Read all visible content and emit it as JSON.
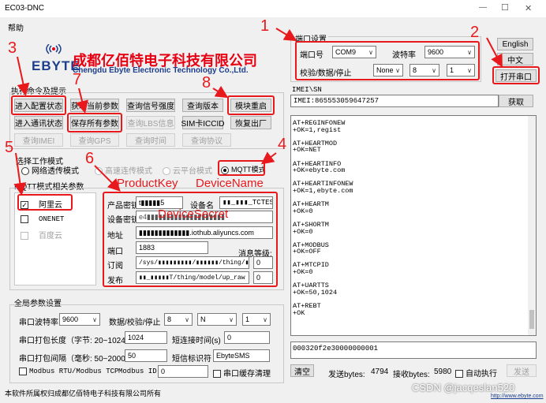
{
  "window": {
    "title": "EC03-DNC",
    "min": "—",
    "max": "☐",
    "close": "✕"
  },
  "menu": {
    "help": "帮助"
  },
  "logo": {
    "brand": "EBYTE",
    "cn": "成都亿佰特电子科技有限公司",
    "en": "Chengdu Ebyte Electronic Technology Co.,Ltd."
  },
  "serial": {
    "group_title": "端口设置",
    "port_label": "端口号",
    "port_value": "COM9",
    "baud_label": "波特率",
    "baud_value": "9600",
    "parity_label": "校验/数据/停止",
    "parity_value": "None",
    "data_bits": "8",
    "stop_bits": "1",
    "open_button": "打开串口"
  },
  "lang": {
    "english": "English",
    "chinese": "中文"
  },
  "cmd": {
    "title": "执行命令及提示",
    "buttons": [
      "进入配置状态",
      "获取当前参数",
      "查询信号强度",
      "查询版本",
      "模块重启",
      "进入通讯状态",
      "保存所有参数",
      "查询LBS信息",
      "SIM卡ICCID",
      "恢复出厂",
      "查询IMEI",
      "查询GPS",
      "查询时间",
      "查询协议"
    ]
  },
  "mode": {
    "title": "选择工作模式",
    "opt1": "网络透传模式",
    "opt2": "高速连传模式",
    "opt3": "云平台模式",
    "opt4": "MQTT模式"
  },
  "mqtt": {
    "title": "MQTT模式相关参数",
    "clouds": [
      "阿里云",
      "ONENET",
      "百度云"
    ],
    "product_key_label": "产品密钥",
    "product_key_value": "t▮▮▮▮▮5",
    "device_name_label": "设备名",
    "device_name_value": "▮▮_▮▮▮_TCTEST",
    "device_secret_label": "设备密钥",
    "device_secret_value": "e4▮▮▮▮▮▮▮▮▮▮▮▮▮▮▮▮▮▮▮▮",
    "address_label": "地址",
    "address_value": "▮▮▮▮▮▮▮▮▮▮▮▮▮.iothub.aliyuncs.com",
    "port_label": "端口",
    "port_value": "1883",
    "qos_label": "消息等级:",
    "sub_label": "订阅",
    "sub_value": "/sys/▮▮▮▮▮▮▮▮▮/▮▮▮▮▮▮/thing/▮▮▮/t",
    "sub_qos": "0",
    "pub_label": "发布",
    "pub_value": "▮▮_▮▮▮▮▮T/thing/model/up_raw",
    "pub_qos": "0"
  },
  "global": {
    "title": "全局参数设置",
    "baud_label": "串口波特率",
    "baud_value": "9600",
    "parity_label": "数据/校验/停止",
    "data_bits": "8",
    "parity": "N",
    "stop_bits": "1",
    "pack_len_label": "串口打包长度（字节: 20~1024）",
    "pack_len_value": "1024",
    "short_time_label": "短连接时间(s)",
    "short_time_value": "0",
    "pack_time_label": "串口打包间隔（毫秒: 50~2000）",
    "pack_time_value": "50",
    "sms_label": "短信标识符",
    "sms_value": "EbyteSMS",
    "modbus_label": "Modbus RTU/Modbus TCP",
    "modbus_id_label": "Modbus ID",
    "modbus_id_value": "0",
    "cache_label": "串口缓存清理"
  },
  "imei": {
    "title": "IMEI\\SN",
    "value": "IMEI:865553059647257",
    "get_button": "获取"
  },
  "log": [
    "AT+REGINFONEW",
    "+OK=1,regist",
    "",
    "AT+HEARTMOD",
    "+OK=NET",
    "",
    "AT+HEARTINFO",
    "+OK=ebyte.com",
    "",
    "AT+HEARTINFONEW",
    "+OK=1,ebyte.com",
    "",
    "AT+HEARTM",
    "+OK=0",
    "",
    "AT+SHORTM",
    "+OK=0",
    "",
    "AT+MODBUS",
    "+OK=OFF",
    "",
    "AT+MTCPID",
    "+OK=0",
    "",
    "AT+UARTTS",
    "+OK=50,1024",
    "",
    "AT+REBT",
    "+OK"
  ],
  "send": {
    "value": "000320f2e30000000001"
  },
  "bottom": {
    "clear": "清空",
    "send_bytes_label": "发送bytes:",
    "send_bytes": "4794",
    "recv_bytes_label": "接收bytes:",
    "recv_bytes": "5980",
    "auto_label": "自动执行",
    "send_button": "发送"
  },
  "footer": {
    "copyright": "本软件所属权归成都亿佰特电子科技有限公司所有",
    "watermark": "CSDN @jacqeslan520",
    "url": "http://www.ebyte.com"
  },
  "annotations": {
    "n1": "1",
    "n2": "2",
    "n3": "3",
    "n4": "4",
    "n5": "5",
    "n6": "6",
    "n7": "7",
    "n8": "8",
    "product_key": "ProductKey",
    "device_name": "DeviceName",
    "device_secret": "DeviceSecret"
  },
  "colors": {
    "accent_red": "#e8191c",
    "logo_red": "#e60012",
    "logo_blue": "#1d3e8c"
  }
}
